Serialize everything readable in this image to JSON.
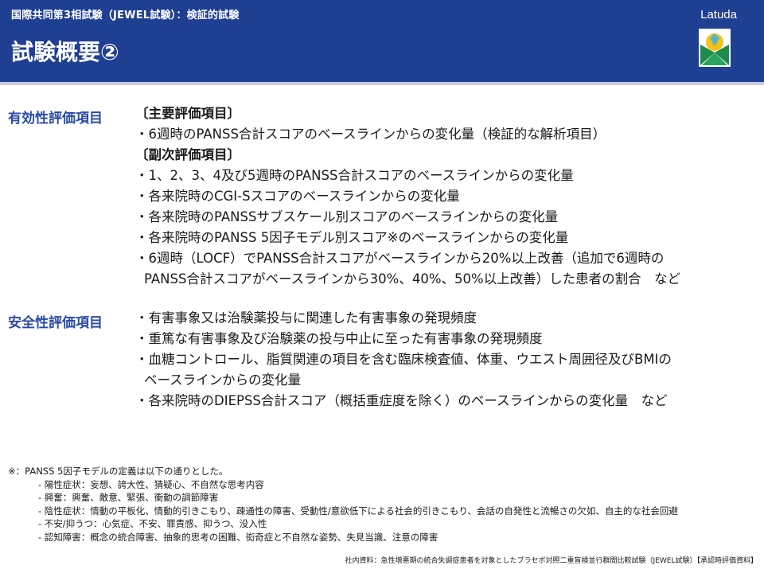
{
  "header": {
    "subtitle": "国際共同第3相試験（JEWEL試験）：検証的試験",
    "title": "試験概要②",
    "logo_text": "Latuda",
    "colors": {
      "band": "#1f3f92",
      "label_blue": "#2a4aa8"
    }
  },
  "efficacy": {
    "label": "有効性評価項目",
    "lines": [
      "〔主要評価項目〕",
      "・6週時のPANSS合計スコアのベースラインからの変化量（検証的な解析項目）",
      "〔副次評価項目〕",
      "・1、2、3、4及び5週時のPANSS合計スコアのベースラインからの変化量",
      "・各来院時のCGI-Sスコアのベースラインからの変化量",
      "・各来院時のPANSSサブスケール別スコアのベースラインからの変化量",
      "・各来院時のPANSS 5因子モデル別スコア※のベースラインからの変化量",
      "・6週時（LOCF）でPANSS合計スコアがベースラインから20%以上改善（追加で6週時の",
      "PANSS合計スコアがベースラインから30%、40%、50%以上改善）した患者の割合　など"
    ]
  },
  "safety": {
    "label": "安全性評価項目",
    "lines": [
      "・有害事象又は治験薬投与に関連した有害事象の発現頻度",
      "・重篤な有害事象及び治験薬の投与中止に至った有害事象の発現頻度",
      "・血糖コントロール、脂質関連の項目を含む臨床検査値、体重、ウエスト周囲径及びBMIの",
      "ベースラインからの変化量",
      "・各来院時のDIEPSS合計スコア（概括重症度を除く）のベースラインからの変化量　など"
    ]
  },
  "notes": {
    "head": "※：PANSS 5因子モデルの定義は以下の通りとした。",
    "items": [
      "- 陽性症状：妄想、誇大性、猜疑心、不自然な思考内容",
      "- 興奮：興奮、敵意、緊張、衝動の調節障害",
      "- 陰性症状：情動の平板化、情動的引きこもり、疎通性の障害、受動性/意欲低下による社会的引きこもり、会話の自発性と流暢さの欠如、自主的な社会回避",
      "- 不安/抑うつ：心気症、不安、罪責感、抑うつ、没入性",
      "- 認知障害：概念の統合障害、抽象的思考の困難、衒奇症と不自然な姿勢、失見当識、注意の障害"
    ]
  },
  "footer": {
    "source": "社内資料：急性増悪期の統合失調症患者を対象としたプラセボ対照二重盲検並行群間比較試験（JEWEL試験）【承認時評価資料】"
  }
}
